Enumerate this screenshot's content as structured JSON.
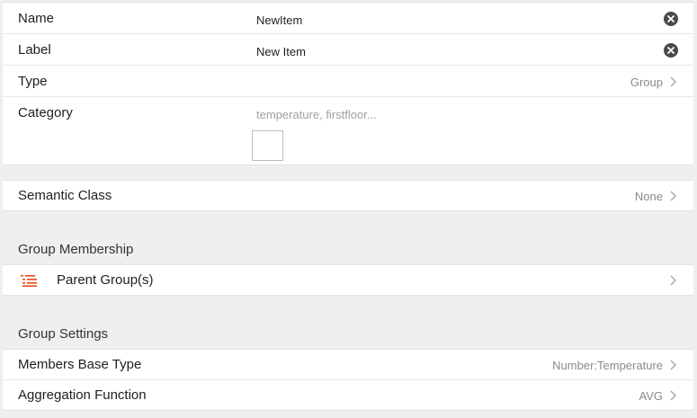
{
  "item": {
    "name": {
      "label": "Name",
      "value": "NewItem"
    },
    "label": {
      "label": "Label",
      "value": "New Item"
    },
    "type": {
      "label": "Type",
      "value": "Group"
    },
    "category": {
      "label": "Category",
      "value": "",
      "placeholder": "temperature, firstfloor..."
    }
  },
  "semantic": {
    "label": "Semantic Class",
    "value": "None"
  },
  "group_membership": {
    "title": "Group Membership",
    "parent_groups_label": "Parent Group(s)",
    "icon": "list-icon"
  },
  "group_settings": {
    "title": "Group Settings",
    "members_base_type": {
      "label": "Members Base Type",
      "value": "Number:Temperature"
    },
    "aggregation_function": {
      "label": "Aggregation Function",
      "value": "AVG"
    }
  },
  "colors": {
    "accent": "#e64a19",
    "clear_button": "#4a4a4a",
    "secondary_text": "#8a8a8a"
  }
}
